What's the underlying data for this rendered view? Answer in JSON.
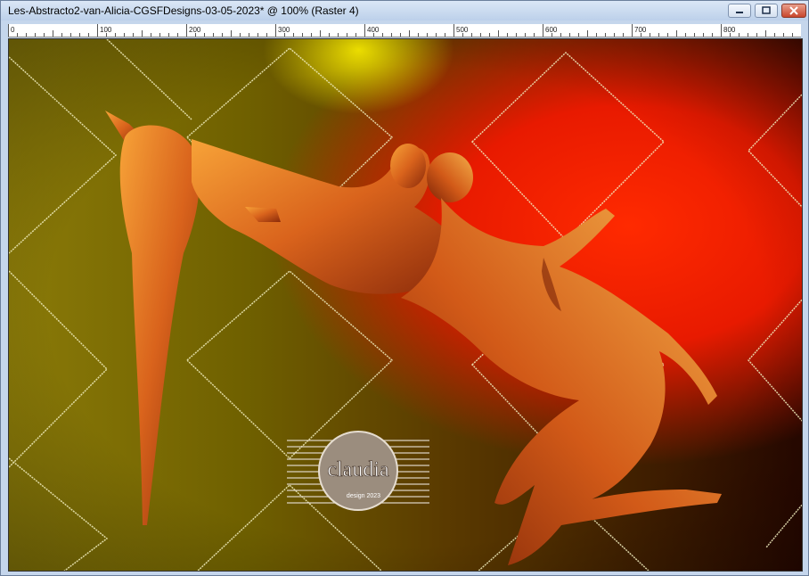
{
  "window": {
    "title": "Les-Abstracto2-van-Alicia-CGSFDesigns-03-05-2023* @ 100% (Raster 4)"
  },
  "ruler": {
    "labels": [
      "0",
      "100",
      "200",
      "300",
      "400",
      "500",
      "600",
      "700",
      "800"
    ]
  },
  "watermark": {
    "text": "claudia",
    "subtext": "design 2023"
  },
  "colors": {
    "accent": "#c8452c",
    "titlebar": "#c5d6ec"
  }
}
